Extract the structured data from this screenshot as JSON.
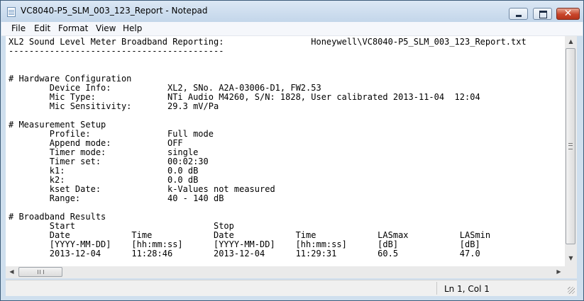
{
  "window": {
    "title": "VC8040-P5_SLM_003_123_Report - Notepad",
    "close_glyph": "✕"
  },
  "menu": {
    "file": "File",
    "edit": "Edit",
    "format": "Format",
    "view": "View",
    "help": "Help"
  },
  "document": {
    "text": "XL2 Sound Level Meter Broadband Reporting:                 Honeywell\\VC8040-P5_SLM_003_123_Report.txt\n------------------------------------------\n\n\n# Hardware Configuration\n        Device Info:           XL2, SNo. A2A-03006-D1, FW2.53\n        Mic Type:              NTi Audio M4260, S/N: 1828, User calibrated 2013-11-04  12:04\n        Mic Sensitivity:       29.3 mV/Pa\n\n# Measurement Setup\n        Profile:               Full mode\n        Append mode:           OFF\n        Timer mode:            single\n        Timer set:             00:02:30\n        k1:                    0.0 dB\n        k2:                    0.0 dB\n        kset Date:             k-Values not measured\n        Range:                 40 - 140 dB\n\n# Broadband Results\n        Start                           Stop\n        Date            Time            Date            Time            LASmax          LASmin\n        [YYYY-MM-DD]    [hh:mm:ss]      [YYYY-MM-DD]    [hh:mm:ss]      [dB]            [dB]\n        2013-12-04      11:28:46        2013-12-04      11:29:31        60.5            47.0"
  },
  "scrollbars": {
    "up_arrow": "▲",
    "down_arrow": "▼",
    "left_arrow": "◀",
    "right_arrow": "▶"
  },
  "status": {
    "position": "Ln 1, Col 1"
  }
}
